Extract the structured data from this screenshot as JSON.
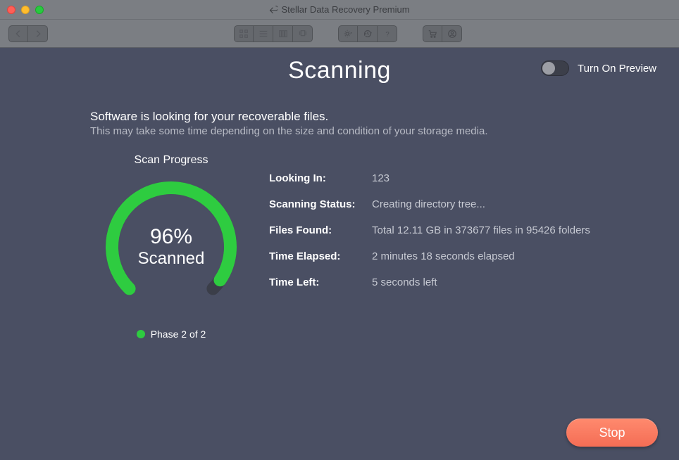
{
  "window": {
    "title": "Stellar Data Recovery Premium"
  },
  "heading": "Scanning",
  "preview": {
    "label": "Turn On Preview"
  },
  "intro": {
    "headline": "Software is looking for your recoverable files.",
    "sub": "This may take some time depending on the size and condition of your storage media."
  },
  "gauge": {
    "title": "Scan Progress",
    "percent_label": "96%",
    "sub_label": "Scanned",
    "percent": 96
  },
  "phase": "Phase 2 of 2",
  "info": {
    "looking_in": {
      "label": "Looking In:",
      "value": "123"
    },
    "status": {
      "label": "Scanning Status:",
      "value": "Creating directory tree..."
    },
    "files": {
      "label": "Files Found:",
      "value": "Total 12.11 GB in 373677 files in 95426 folders"
    },
    "elapsed": {
      "label": "Time Elapsed:",
      "value": "2 minutes 18 seconds elapsed"
    },
    "left": {
      "label": "Time Left:",
      "value": "5 seconds left"
    }
  },
  "footer": {
    "stop": "Stop"
  }
}
